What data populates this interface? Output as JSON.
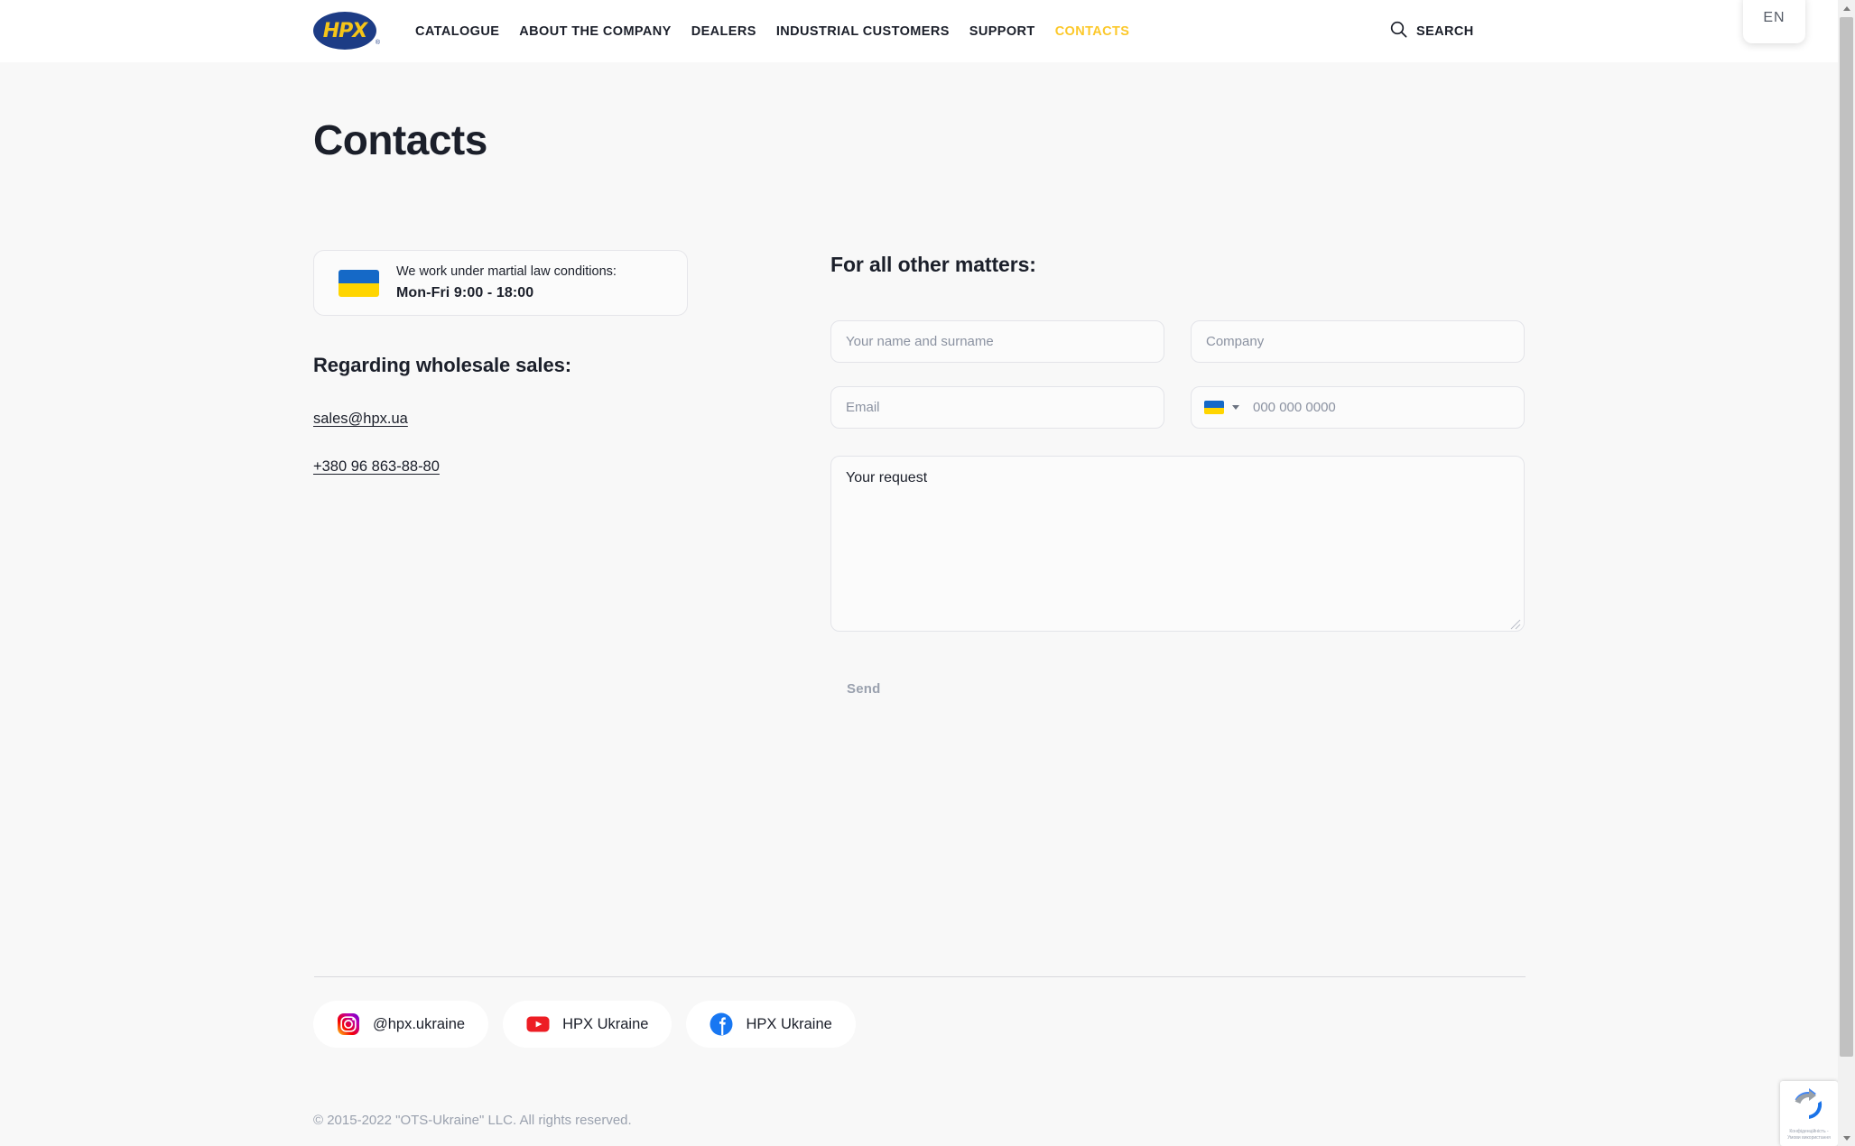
{
  "header": {
    "logo_text": "HPX",
    "logo_tm": "®",
    "nav": [
      {
        "label": "CATALOGUE",
        "active": false
      },
      {
        "label": "ABOUT THE COMPANY",
        "active": false
      },
      {
        "label": "DEALERS",
        "active": false
      },
      {
        "label": "INDUSTRIAL CUSTOMERS",
        "active": false
      },
      {
        "label": "SUPPORT",
        "active": false
      },
      {
        "label": "CONTACTS",
        "active": true
      }
    ],
    "search_label": "SEARCH",
    "language": "EN",
    "accent_color": "#fcc82a",
    "logo_blue": "#1d3c85",
    "logo_yellow": "#f5c518"
  },
  "page": {
    "title": "Contacts"
  },
  "left_column": {
    "notice": {
      "line1": "We work under martial law conditions:",
      "line2": "Mon-Fri 9:00 - 18:00",
      "flag": "ukraine-flag"
    },
    "wholesale_title": "Regarding wholesale sales:",
    "email": "sales@hpx.ua",
    "phone": "+380 96 863-88-80"
  },
  "form": {
    "title": "For all other matters:",
    "fields": {
      "name": {
        "placeholder": "Your name and surname",
        "value": ""
      },
      "company": {
        "placeholder": "Company",
        "value": ""
      },
      "email": {
        "placeholder": "Email",
        "value": ""
      },
      "phone": {
        "placeholder": "000 000 0000",
        "value": "",
        "country_flag": "ukraine-flag"
      },
      "request": {
        "placeholder": "Your request",
        "value": ""
      }
    },
    "submit_label": "Send",
    "submit_disabled": true
  },
  "footer": {
    "socials": [
      {
        "network": "instagram",
        "label": "@hpx.ukraine"
      },
      {
        "network": "youtube",
        "label": "HPX Ukraine"
      },
      {
        "network": "facebook",
        "label": "HPX Ukraine"
      }
    ],
    "copyright": "© 2015-2022 \"OTS-Ukraine\" LLC. All rights reserved."
  },
  "recaptcha": {
    "text": "Конфіденційність - Умови використання"
  }
}
